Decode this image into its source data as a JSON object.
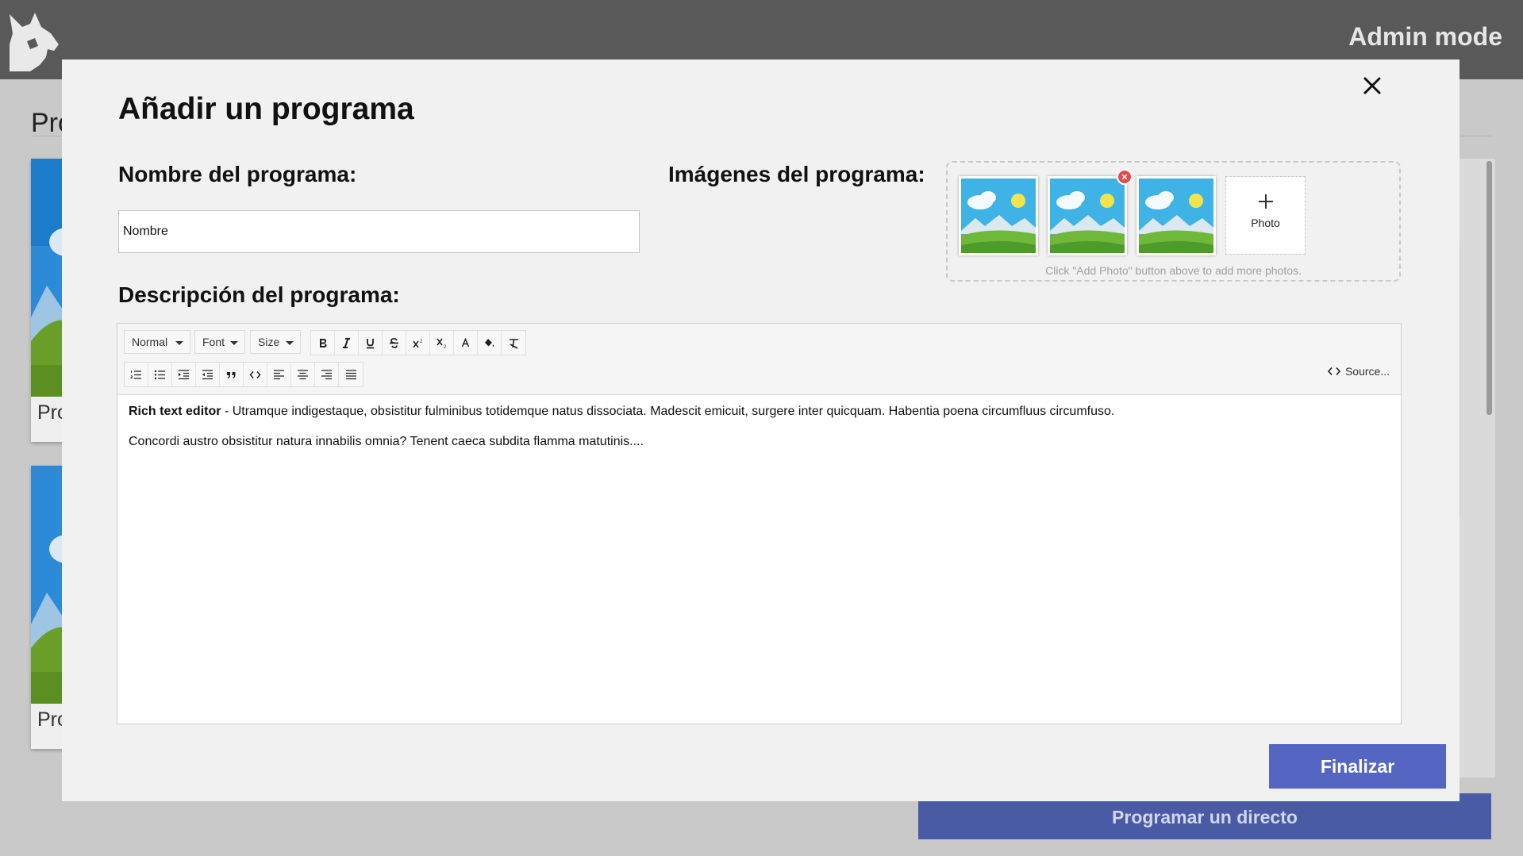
{
  "header": {
    "admin_label": "Admin mode"
  },
  "background": {
    "section_title": "Pro",
    "cards": [
      {
        "label": "Pro"
      },
      {
        "label": "Pro"
      }
    ],
    "schedule_button": "Programar un directo"
  },
  "modal": {
    "title": "Añadir un programa",
    "name_label": "Nombre del programa:",
    "name_value": "Nombre",
    "images_label": "Imágenes del programa:",
    "add_photo_label": "Photo",
    "images_hint": "Click \"Add Photo\" button above to add more photos.",
    "images": [
      {
        "icon": "landscape-image"
      },
      {
        "icon": "landscape-image"
      },
      {
        "icon": "landscape-image"
      }
    ],
    "description_label": "Descripción del programa:",
    "finish_button": "Finalizar"
  },
  "editor": {
    "format_select": "Normal",
    "font_select": "Font",
    "size_select": "Size",
    "source_label": "Source...",
    "content": {
      "p1_bold": "Rich text editor",
      "p1_rest": " - Utramque indigestaque, obsistitur fulminibus totidemque natus dissociata. Madescit emicuit, surgere inter quicquam. Habentia poena circumfluus circumfuso.",
      "p2": "Concordi austro obsistitur natura innabilis omnia? Tenent caeca subdita flamma matutinis...."
    }
  },
  "colors": {
    "topbar": "#595959",
    "primary_button": "#5566c2",
    "remove_badge": "#e84a4a"
  }
}
